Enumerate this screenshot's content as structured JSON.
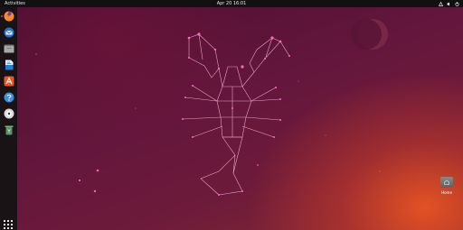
{
  "topbar": {
    "activities_label": "Activities",
    "clock": "Apr 20  16:01"
  },
  "dock": {
    "apps": [
      {
        "name": "Firefox",
        "icon": "firefox-icon",
        "running": true
      },
      {
        "name": "Thunderbird Mail",
        "icon": "thunderbird-icon",
        "running": false
      },
      {
        "name": "Files",
        "icon": "files-icon",
        "running": false
      },
      {
        "name": "LibreOffice Writer",
        "icon": "libreoffice-writer-icon",
        "running": false
      },
      {
        "name": "Ubuntu Software",
        "icon": "ubuntu-software-icon",
        "running": false
      },
      {
        "name": "Help",
        "icon": "help-icon",
        "running": false
      },
      {
        "name": "Disc",
        "icon": "disc-icon",
        "running": false
      },
      {
        "name": "Trash",
        "icon": "trash-icon",
        "running": false
      }
    ],
    "show_apps_icon": "grid-icon"
  },
  "desktop": {
    "home_label": "Home"
  },
  "colors": {
    "accent": "#e95420",
    "topbar": "#111111",
    "wallpaper": "#5a1234",
    "constellation": "#f5b4d8",
    "star": "#ff5fb8"
  }
}
